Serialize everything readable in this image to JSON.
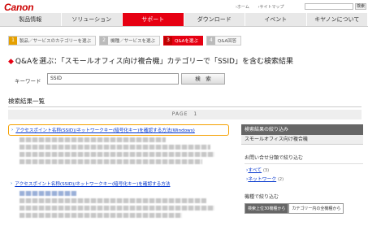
{
  "header": {
    "logo": "Canon",
    "util_links": [
      "›ホーム",
      "›サイトマップ"
    ],
    "search_button": "検索"
  },
  "nav": {
    "items": [
      "製品情報",
      "ソリューション",
      "サポート",
      "ダウンロード",
      "イベント",
      "キヤノンについて"
    ],
    "active": "サポート"
  },
  "steps": [
    {
      "num": "1",
      "label": "製品／サービスのカテゴリーを選ぶ"
    },
    {
      "num": "2",
      "label": "機種／サービスを選ぶ"
    },
    {
      "num": "3",
      "label": "Q&Aを選ぶ"
    },
    {
      "num": "4",
      "label": "Q&A回答"
    }
  ],
  "heading": "Q&Aを選ぶ：「スモールオフィス向け複合機」カテゴリーで「SSID」を含む検索結果",
  "keyword": {
    "label": "キーワード",
    "value": "SSID",
    "button": "検　索"
  },
  "results": {
    "title": "検索結果一覧",
    "page_label": "PAGE　1",
    "items": [
      {
        "title": "アクセスポイント名称(SSID)/ネットワークキー(暗号化キー)を確認する方法(Windows)"
      },
      {
        "title": "アクセスポイント名称(SSID)/ネットワークキー(暗号化キー)を確認する方法"
      }
    ]
  },
  "sidebar": {
    "title": "検索結果の絞り込み",
    "category": "スモールオフィス向け複合機",
    "question_section": "お問い合せ分類で絞り込む",
    "links": [
      {
        "label": "すべて",
        "count": "(3)"
      },
      {
        "label": "ネットワーク",
        "count": "(2)"
      }
    ],
    "sort_section": "機種で絞り込む",
    "tabs": [
      "検索上位30機種から",
      "カテゴリー内の全機種から"
    ]
  }
}
